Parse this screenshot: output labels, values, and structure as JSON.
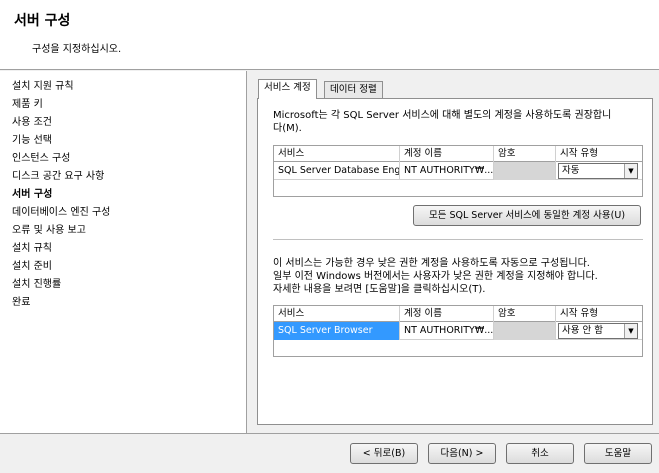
{
  "header": {
    "title": "서버 구성",
    "subtitle": "구성을 지정하십시오."
  },
  "sidebar": {
    "items": [
      {
        "label": "설치 지원 규칙",
        "active": false
      },
      {
        "label": "제품 키",
        "active": false
      },
      {
        "label": "사용 조건",
        "active": false
      },
      {
        "label": "기능 선택",
        "active": false
      },
      {
        "label": "인스턴스 구성",
        "active": false
      },
      {
        "label": "디스크 공간 요구 사항",
        "active": false
      },
      {
        "label": "서버 구성",
        "active": true
      },
      {
        "label": "데이터베이스 엔진 구성",
        "active": false
      },
      {
        "label": "오류 및 사용 보고",
        "active": false
      },
      {
        "label": "설치 규칙",
        "active": false
      },
      {
        "label": "설치 준비",
        "active": false
      },
      {
        "label": "설치 진행률",
        "active": false
      },
      {
        "label": "완료",
        "active": false
      }
    ]
  },
  "tabs": [
    {
      "label": "서비스 계정",
      "active": true
    },
    {
      "label": "데이터 정렬",
      "active": false
    }
  ],
  "service_accounts": {
    "description_line1": "Microsoft는 각 SQL Server 서비스에 대해 별도의 계정을 사용하도록 권장합니",
    "description_line2": "다(M).",
    "columns": [
      "서비스",
      "계정 이름",
      "암호",
      "시작 유형"
    ],
    "rows": [
      {
        "service": "SQL Server Database Eng...",
        "account": "NT AUTHORITY₩...",
        "password": "",
        "startup": "자동"
      }
    ],
    "same_account_button": "모든 SQL Server 서비스에 동일한 계정 사용(U)"
  },
  "low_privilege": {
    "line1": "이 서비스는 가능한 경우 낮은 권한 계정을 사용하도록 자동으로 구성됩니다.",
    "line2": "일부 이전 Windows 버전에서는 사용자가 낮은 권한 계정을 지정해야 합니다.",
    "line3": "자세한 내용을 보려면 [도움말]을 클릭하십시오(T).",
    "columns": [
      "서비스",
      "계정 이름",
      "암호",
      "시작 유형"
    ],
    "rows": [
      {
        "service": "SQL Server Browser",
        "account": "NT AUTHORITY₩...",
        "password": "",
        "startup": "사용 안 함"
      }
    ]
  },
  "footer": {
    "back": "< 뒤로(B)",
    "next": "다음(N) >",
    "cancel": "취소",
    "help": "도움말"
  },
  "icons": {
    "dropdown": "chevron-down-icon"
  },
  "colors": {
    "selection": "#3399ff",
    "header_bg": "#ffffff",
    "window_bg": "#f0f0f0"
  }
}
